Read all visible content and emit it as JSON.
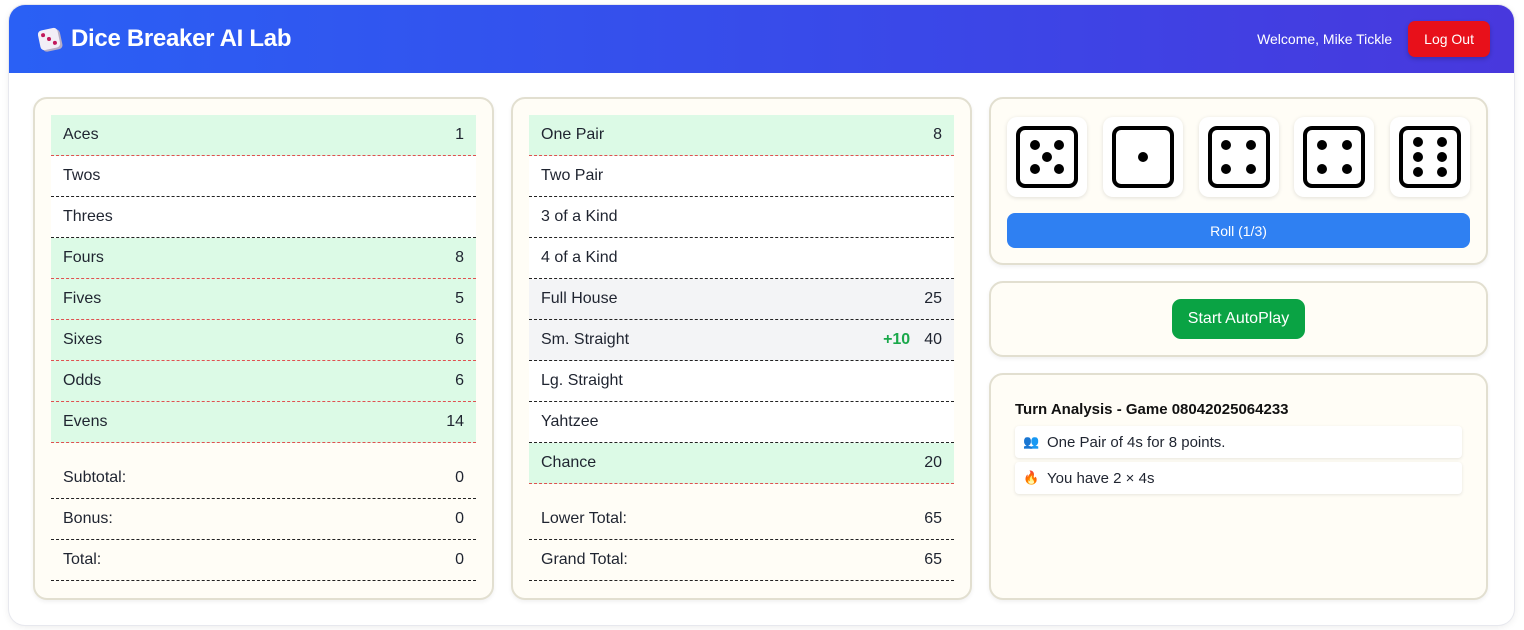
{
  "header": {
    "title": "Dice Breaker AI Lab",
    "brand_icon": "dice-icon",
    "welcome": "Welcome, Mike Tickle",
    "logout_label": "Log Out",
    "gradient": [
      "#2a60f5",
      "#4838dd"
    ]
  },
  "upper": {
    "rows": [
      {
        "name": "Aces",
        "value": "1",
        "state": "scored"
      },
      {
        "name": "Twos",
        "value": "",
        "state": "open"
      },
      {
        "name": "Threes",
        "value": "",
        "state": "open"
      },
      {
        "name": "Fours",
        "value": "8",
        "state": "scored"
      },
      {
        "name": "Fives",
        "value": "5",
        "state": "scored"
      },
      {
        "name": "Sixes",
        "value": "6",
        "state": "scored"
      },
      {
        "name": "Odds",
        "value": "6",
        "state": "scored"
      },
      {
        "name": "Evens",
        "value": "14",
        "state": "scored"
      }
    ],
    "subtotal_label": "Subtotal:",
    "subtotal": "0",
    "bonus_label": "Bonus:",
    "bonus": "0",
    "total_label": "Total:",
    "total": "0"
  },
  "lower": {
    "rows": [
      {
        "name": "One Pair",
        "value": "8",
        "state": "scored",
        "tag": ""
      },
      {
        "name": "Two Pair",
        "value": "",
        "state": "open",
        "tag": ""
      },
      {
        "name": "3 of a Kind",
        "value": "",
        "state": "open",
        "tag": ""
      },
      {
        "name": "4 of a Kind",
        "value": "",
        "state": "open",
        "tag": ""
      },
      {
        "name": "Full House",
        "value": "25",
        "state": "preview",
        "tag": ""
      },
      {
        "name": "Sm. Straight",
        "value": "40",
        "state": "preview",
        "tag": "+10"
      },
      {
        "name": "Lg. Straight",
        "value": "",
        "state": "open",
        "tag": ""
      },
      {
        "name": "Yahtzee",
        "value": "",
        "state": "open",
        "tag": ""
      },
      {
        "name": "Chance",
        "value": "20",
        "state": "scored",
        "tag": ""
      }
    ],
    "lower_total_label": "Lower Total:",
    "lower_total": "65",
    "grand_total_label": "Grand Total:",
    "grand_total": "65"
  },
  "dice": {
    "values": [
      5,
      1,
      4,
      4,
      6
    ],
    "roll_label": "Roll (1/3)"
  },
  "autoplay": {
    "label": "Start AutoPlay"
  },
  "analysis": {
    "title": "Turn Analysis - Game 08042025064233",
    "messages": [
      {
        "icon": "pair-people-icon",
        "glyph": "👥",
        "text": "One Pair of 4s for 8 points."
      },
      {
        "icon": "flame-hand-icon",
        "glyph": "🔥",
        "text": "You have 2 × 4s"
      }
    ]
  },
  "colors": {
    "scored_bg": "#dcfae6",
    "roll_button": "#2f80f2",
    "autoplay_button": "#0aa344",
    "logout_button": "#e8101a",
    "bonus_text": "#1aa84b"
  }
}
